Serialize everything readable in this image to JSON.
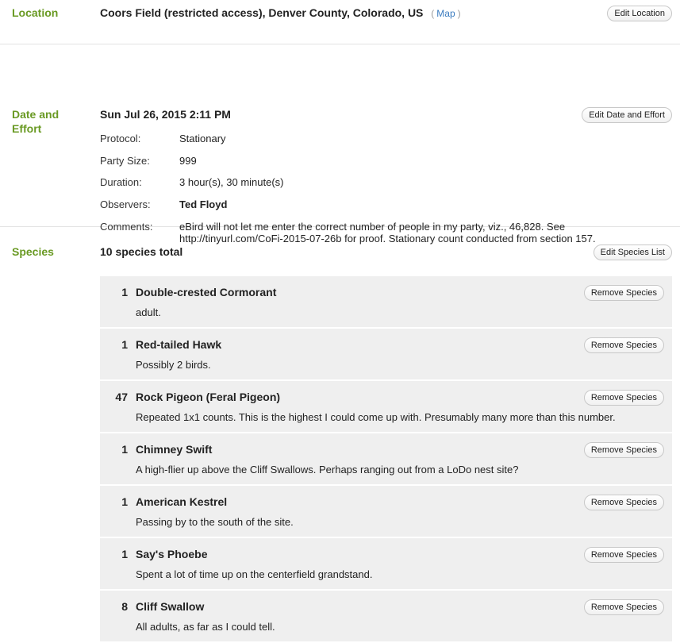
{
  "location": {
    "label": "Location",
    "name": "Coors Field (restricted access), Denver County, Colorado, US",
    "map_open": "(",
    "map_label": "Map",
    "map_close": ")",
    "edit_button": "Edit Location"
  },
  "date_effort": {
    "label": "Date and Effort",
    "datetime": "Sun Jul 26, 2015 2:11 PM",
    "edit_button": "Edit Date and Effort",
    "fields": [
      {
        "key": "Protocol:",
        "value": "Stationary"
      },
      {
        "key": "Party Size:",
        "value": "999"
      },
      {
        "key": "Duration:",
        "value": "3 hour(s), 30 minute(s)"
      },
      {
        "key": "Observers:",
        "value": "Ted Floyd"
      },
      {
        "key": "Comments:",
        "value": "eBird will not let me enter the correct number of people in my party, viz., 46,828. See http://tinyurl.com/CoFi-2015-07-26b for proof. Stationary count conducted from section 157."
      }
    ]
  },
  "species": {
    "label": "Species",
    "total": "10 species total",
    "edit_button": "Edit Species List",
    "remove_label": "Remove Species",
    "items": [
      {
        "count": "1",
        "name": "Double-crested Cormorant",
        "comment": "adult."
      },
      {
        "count": "1",
        "name": "Red-tailed Hawk",
        "comment": "Possibly 2 birds."
      },
      {
        "count": "47",
        "name": "Rock Pigeon (Feral Pigeon)",
        "comment": "Repeated 1x1 counts. This is the highest I could come up with. Presumably many more than this number."
      },
      {
        "count": "1",
        "name": "Chimney Swift",
        "comment": "A high-flier up above the Cliff Swallows. Perhaps ranging out from a LoDo nest site?"
      },
      {
        "count": "1",
        "name": "American Kestrel",
        "comment": "Passing by to the south of the site."
      },
      {
        "count": "1",
        "name": "Say's Phoebe",
        "comment": "Spent a lot of time up on the centerfield grandstand."
      },
      {
        "count": "8",
        "name": "Cliff Swallow",
        "comment": "All adults, as far as I could tell."
      }
    ]
  },
  "colors": {
    "label_green": "#6a9a24",
    "link_blue": "#3a7bbf",
    "row_bg": "#efefef"
  }
}
